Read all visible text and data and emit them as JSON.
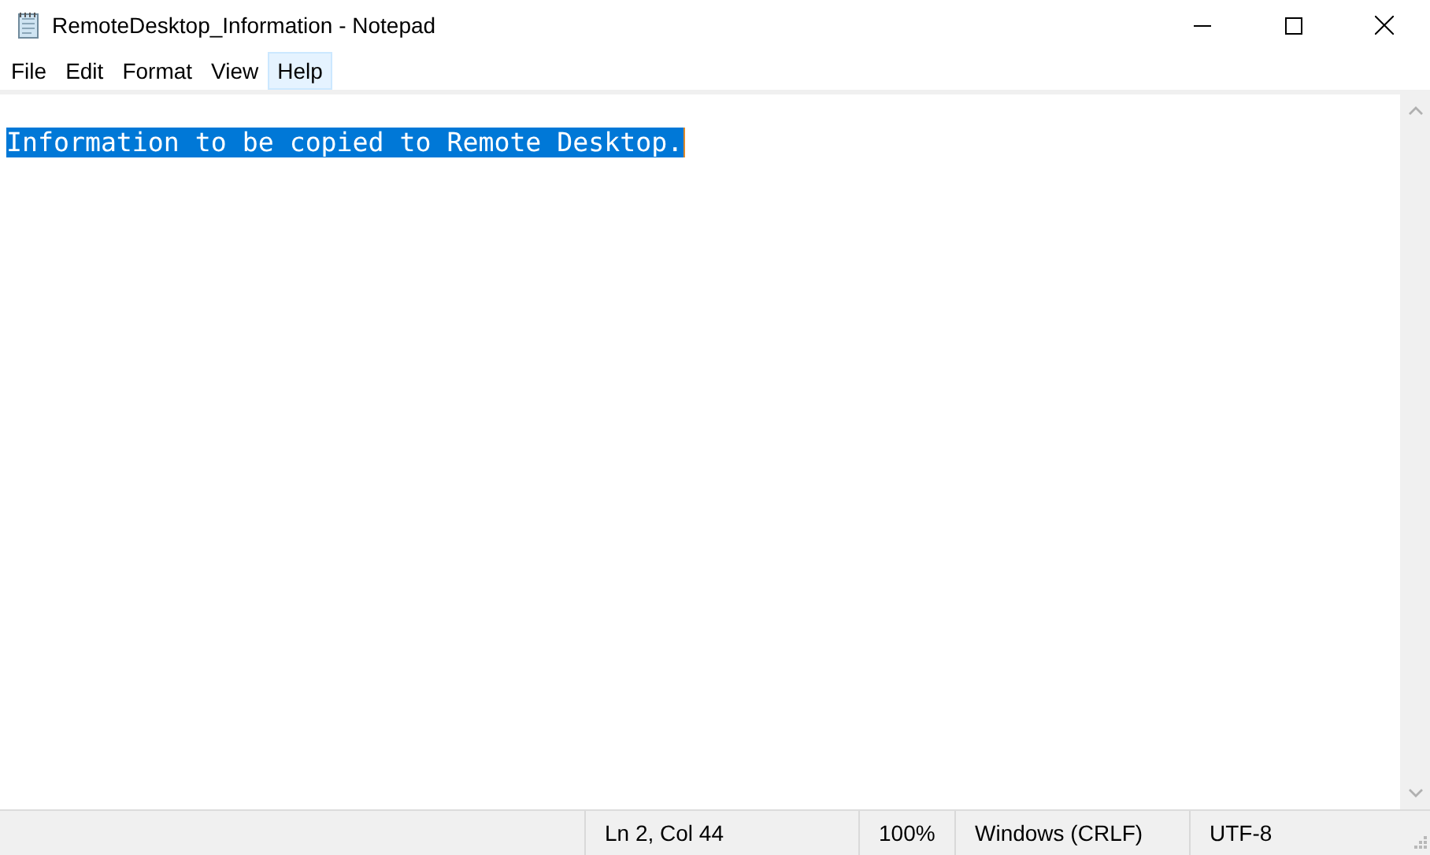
{
  "window": {
    "title": "RemoteDesktop_Information - Notepad"
  },
  "menu": [
    {
      "label": "File",
      "highlighted": false
    },
    {
      "label": "Edit",
      "highlighted": false
    },
    {
      "label": "Format",
      "highlighted": false
    },
    {
      "label": "View",
      "highlighted": false
    },
    {
      "label": "Help",
      "highlighted": true
    }
  ],
  "editor": {
    "lines": [
      {
        "text": "Information to be copied to Remote Desktop.",
        "selected": true
      }
    ]
  },
  "status_bar": [
    "Ln 2, Col 44",
    "100%",
    "Windows (CRLF)",
    "UTF-8"
  ]
}
